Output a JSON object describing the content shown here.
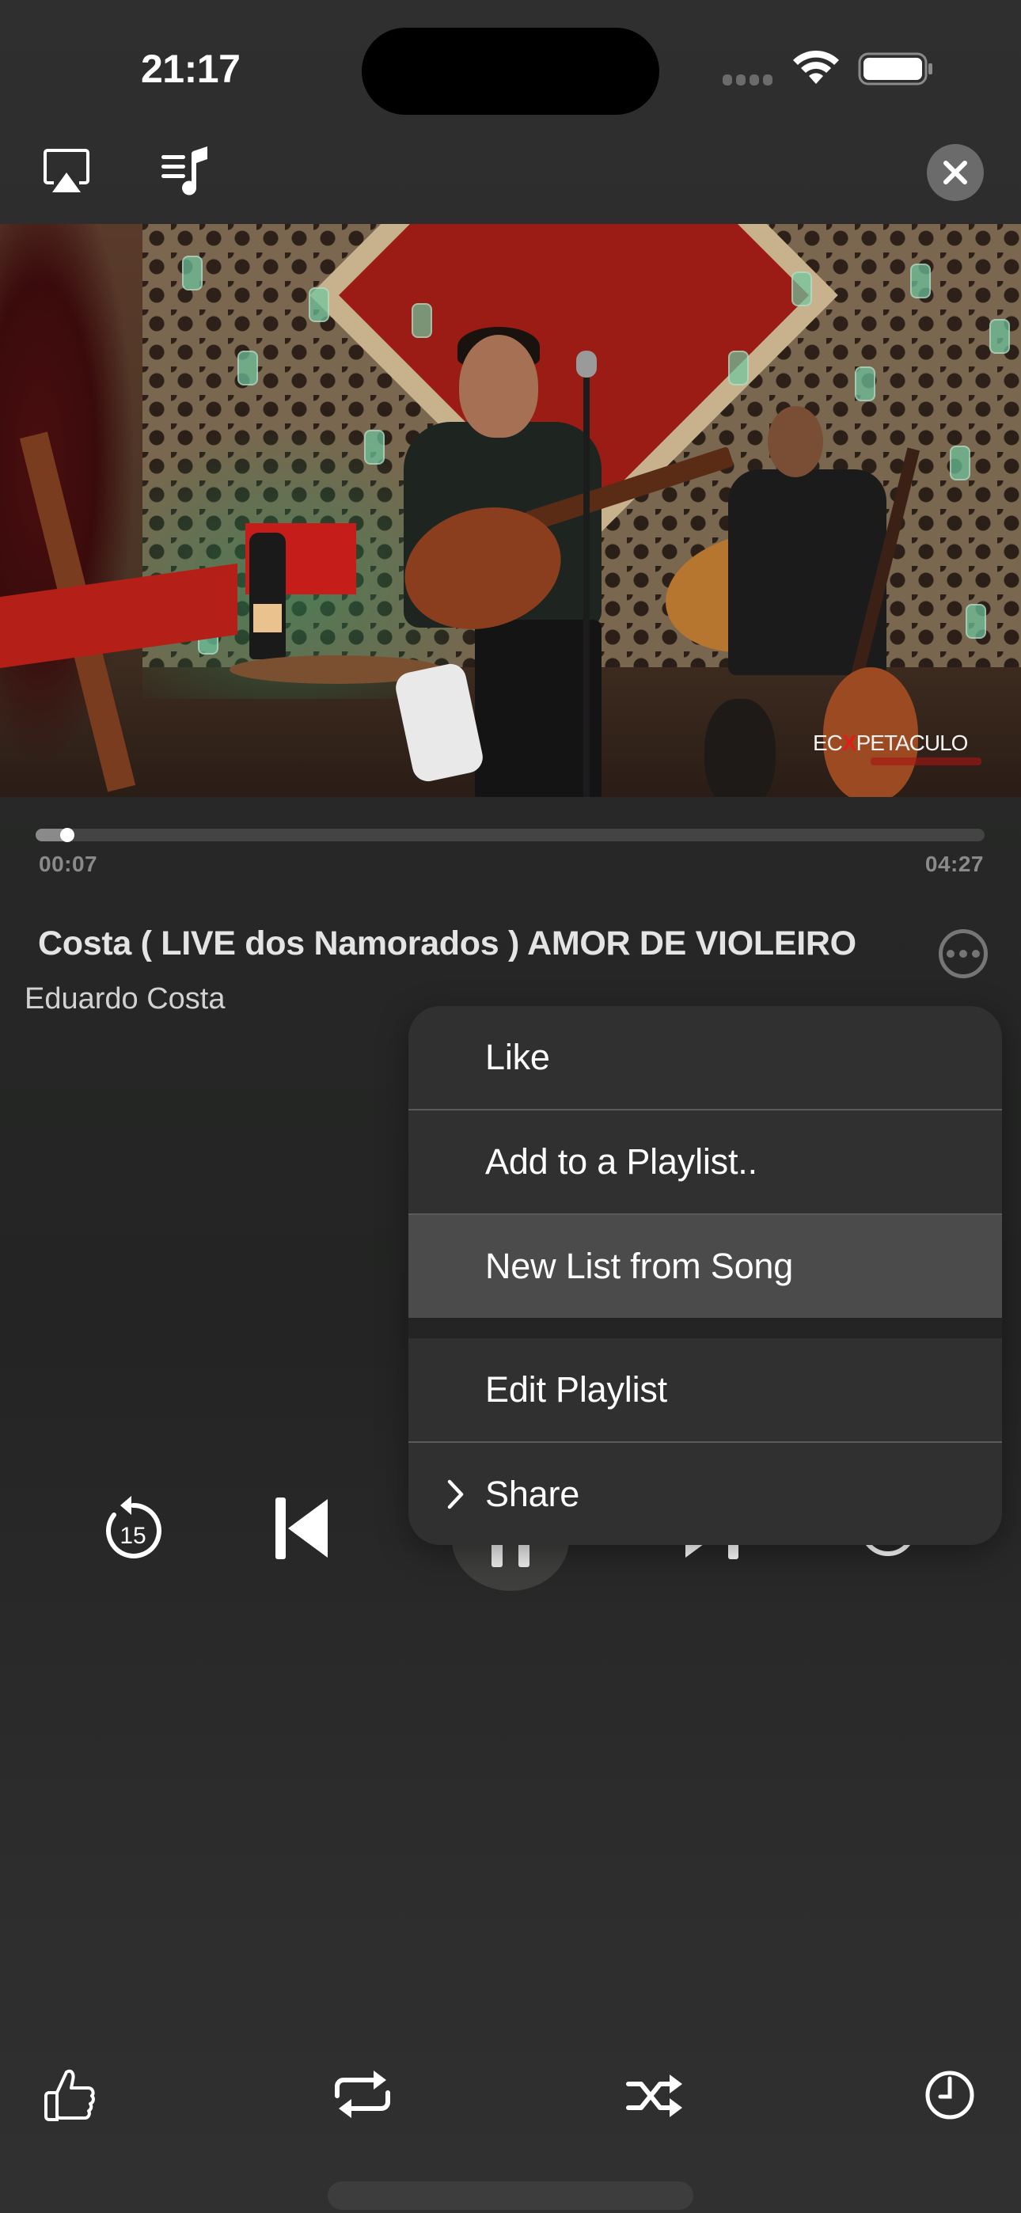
{
  "status_bar": {
    "time": "21:17",
    "signal": "no-service-dots",
    "wifi": "wifi-icon",
    "battery": "battery-full-icon"
  },
  "toolbar": {
    "airplay_icon": "airplay-icon",
    "queue_icon": "music-queue-icon",
    "close_icon": "close-icon"
  },
  "video": {
    "watermark_left": "EC",
    "watermark_x": "X",
    "watermark_right": "PETACULO"
  },
  "progress": {
    "elapsed": "00:07",
    "total": "04:27",
    "fraction": 0.026
  },
  "track": {
    "title": "Costa ( LIVE dos Namorados )  AMOR DE VIOLEIRO",
    "artist": "Eduardo Costa",
    "more_icon": "ellipsis-circle-icon"
  },
  "controls": {
    "skip_back_seconds": "15",
    "skip_back_icon": "rewind-15-icon",
    "previous_icon": "previous-track-icon",
    "play_pause_icon": "pause-icon",
    "next_icon": "next-track-icon",
    "extra_icon": "circle-icon"
  },
  "context_menu": {
    "items": [
      {
        "label": "Like",
        "highlighted": false
      },
      {
        "label": "Add to a Playlist..",
        "highlighted": false
      },
      {
        "label": "New List from Song",
        "highlighted": true
      },
      {
        "label": "Edit Playlist",
        "highlighted": false
      },
      {
        "label": "Share",
        "highlighted": false,
        "submenu": true
      }
    ]
  },
  "bottom_bar": {
    "like_icon": "thumbs-up-icon",
    "repeat_icon": "repeat-icon",
    "shuffle_icon": "shuffle-icon",
    "timer_icon": "clock-icon"
  },
  "colors": {
    "background": "#2b2b2b",
    "menu_background": "#303030",
    "menu_highlight": "#4b4b4b",
    "secondary_text": "#8a8a8a",
    "progress_track": "#444444"
  }
}
